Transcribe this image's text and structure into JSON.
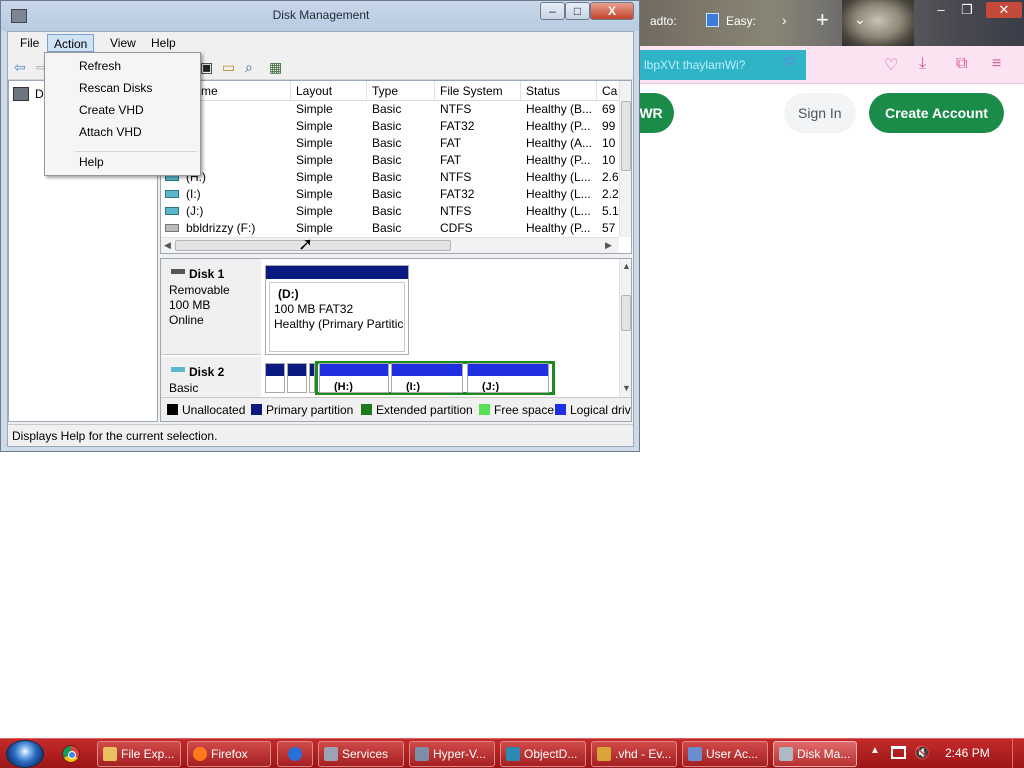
{
  "browser": {
    "tabs": [
      {
        "label": "adto:"
      },
      {
        "label": "Easy:"
      }
    ],
    "url_fragment": "lbpXVt thaylamWi?",
    "page_buttons": {
      "wr": "WR",
      "sign_in": "Sign In",
      "create_account": "Create Account"
    },
    "colors": {
      "toolbar": "#fbe3f1",
      "accent_green": "#1b8b4a",
      "url_bar": "#2fb3c6"
    }
  },
  "window": {
    "title": "Disk Management",
    "controls": {
      "minimize": "–",
      "maximize": "□",
      "close": "X"
    }
  },
  "menubar": {
    "file": "File",
    "action": "Action",
    "view": "View",
    "help": "Help"
  },
  "action_menu": {
    "items": [
      "Refresh",
      "Rescan Disks",
      "Create VHD",
      "Attach VHD"
    ],
    "help": "Help"
  },
  "tree": {
    "label": "Di"
  },
  "volume_list": {
    "columns": [
      {
        "label": "me"
      },
      {
        "label": "Layout"
      },
      {
        "label": "Type"
      },
      {
        "label": "File System"
      },
      {
        "label": "Status"
      },
      {
        "label": "Ca"
      }
    ],
    "rows": [
      {
        "volume": "",
        "layout": "Simple",
        "type": "Basic",
        "fs": "NTFS",
        "status": "Healthy (B...",
        "cap": "69"
      },
      {
        "volume": "",
        "layout": "Simple",
        "type": "Basic",
        "fs": "FAT32",
        "status": "Healthy (P...",
        "cap": "99"
      },
      {
        "volume": "",
        "layout": "Simple",
        "type": "Basic",
        "fs": "FAT",
        "status": "Healthy (A...",
        "cap": "10"
      },
      {
        "volume": "",
        "layout": "Simple",
        "type": "Basic",
        "fs": "FAT",
        "status": "Healthy (P...",
        "cap": "10"
      },
      {
        "volume": "(H:)",
        "layout": "Simple",
        "type": "Basic",
        "fs": "NTFS",
        "status": "Healthy (L...",
        "cap": "2.6"
      },
      {
        "volume": "(I:)",
        "layout": "Simple",
        "type": "Basic",
        "fs": "FAT32",
        "status": "Healthy (L...",
        "cap": "2.2"
      },
      {
        "volume": "(J:)",
        "layout": "Simple",
        "type": "Basic",
        "fs": "NTFS",
        "status": "Healthy (L...",
        "cap": "5.1"
      },
      {
        "volume": "bbldrizzy (F:)",
        "layout": "Simple",
        "type": "Basic",
        "fs": "CDFS",
        "status": "Healthy (P...",
        "cap": "57"
      }
    ]
  },
  "disks": {
    "disk1": {
      "name": "Disk 1",
      "kind": "Removable",
      "size": "100 MB",
      "state": "Online",
      "partition": {
        "letter": "(D:)",
        "size_fs": "100 MB FAT32",
        "status": "Healthy (Primary Partitic"
      }
    },
    "disk2": {
      "name": "Disk 2",
      "kind": "Basic",
      "partitions": [
        {
          "label": "(H:)"
        },
        {
          "label": "(I:)"
        },
        {
          "label": "(J:)"
        }
      ]
    }
  },
  "legend": [
    {
      "label": "Unallocated",
      "color": "#000000"
    },
    {
      "label": "Primary partition",
      "color": "#0a1a80"
    },
    {
      "label": "Extended partition",
      "color": "#1c7a1c"
    },
    {
      "label": "Free space",
      "color": "#55e055"
    },
    {
      "label": "Logical drive",
      "color": "#1e2ee0"
    }
  ],
  "status_bar": "Displays Help for the current selection.",
  "taskbar": {
    "tasks": [
      {
        "label": "File Exp...",
        "icon_color": "#e8c060"
      },
      {
        "label": "Firefox",
        "icon_color": "#ff7a1a"
      },
      {
        "label": "",
        "icon_color": "#2a6fd8"
      },
      {
        "label": "Services",
        "icon_color": "#9aa4b4"
      },
      {
        "label": "Hyper-V...",
        "icon_color": "#7d8ea8"
      },
      {
        "label": "ObjectD...",
        "icon_color": "#2a8ab0"
      },
      {
        "label": ".vhd - Ev...",
        "icon_color": "#d9a43a"
      },
      {
        "label": "User Ac...",
        "icon_color": "#6a8fd0"
      },
      {
        "label": "Disk Ma...",
        "icon_color": "#b0b8c4"
      }
    ],
    "clock": "2:46 PM"
  }
}
